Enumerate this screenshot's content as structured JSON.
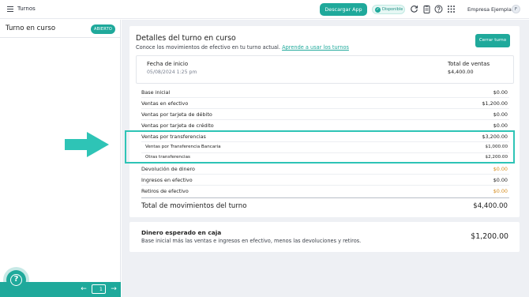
{
  "topbar": {
    "title": "Turnos",
    "download_label": "Descargar App",
    "status_label": "Disponible",
    "company": "Empresa Ejemplar",
    "avatar_initial": "F"
  },
  "sidebar": {
    "title": "Turno en curso",
    "badge": "ABIERTO",
    "page": "1"
  },
  "details": {
    "title": "Detalles del turno en curso",
    "subtitle": "Conoce los movimientos de efectivo en tu turno actual.",
    "link": "Aprende a usar los turnos",
    "close_button": "Cerrar turno",
    "start_label": "Fecha de inicio",
    "start_value": "05/08/2024 1:25 pm",
    "total_sales_label": "Total de ventas",
    "total_sales_value": "$4,400.00",
    "rows": [
      {
        "label": "Base inicial",
        "value": "$0.00"
      },
      {
        "label": "Ventas en efectivo",
        "value": "$1,200.00"
      },
      {
        "label": "Ventas por tarjeta de débito",
        "value": "$0.00"
      },
      {
        "label": "Ventas por tarjeta de crédito",
        "value": "$0.00"
      },
      {
        "label": "Ventas por transferencias",
        "value": "$3,200.00"
      },
      {
        "label": "Ventas por Transferencia Bancaria",
        "value": "$1,000.00"
      },
      {
        "label": "Otras transferencias",
        "value": "$2,200.00"
      },
      {
        "label": "Devolución de dinero",
        "value": "$0.00"
      },
      {
        "label": "Ingresos en efectivo",
        "value": "$0.00"
      },
      {
        "label": "Retiros de efectivo",
        "value": "$0.00"
      }
    ],
    "total_label": "Total de movimientos del turno",
    "total_value": "$4,400.00"
  },
  "cash": {
    "title": "Dinero esperado en caja",
    "subtitle": "Base inicial más las ventas e ingresos en efectivo, menos las devoluciones y retiros.",
    "value": "$1,200.00"
  },
  "colors": {
    "accent": "#1fa99b",
    "highlight": "#2ec4b6",
    "negative": "#d48a1a"
  },
  "icons": [
    "menu-icon",
    "refresh-icon",
    "clipboard-icon",
    "help-circle-icon",
    "apps-grid-icon",
    "arrow-left-icon",
    "arrow-right-icon",
    "help-icon"
  ]
}
